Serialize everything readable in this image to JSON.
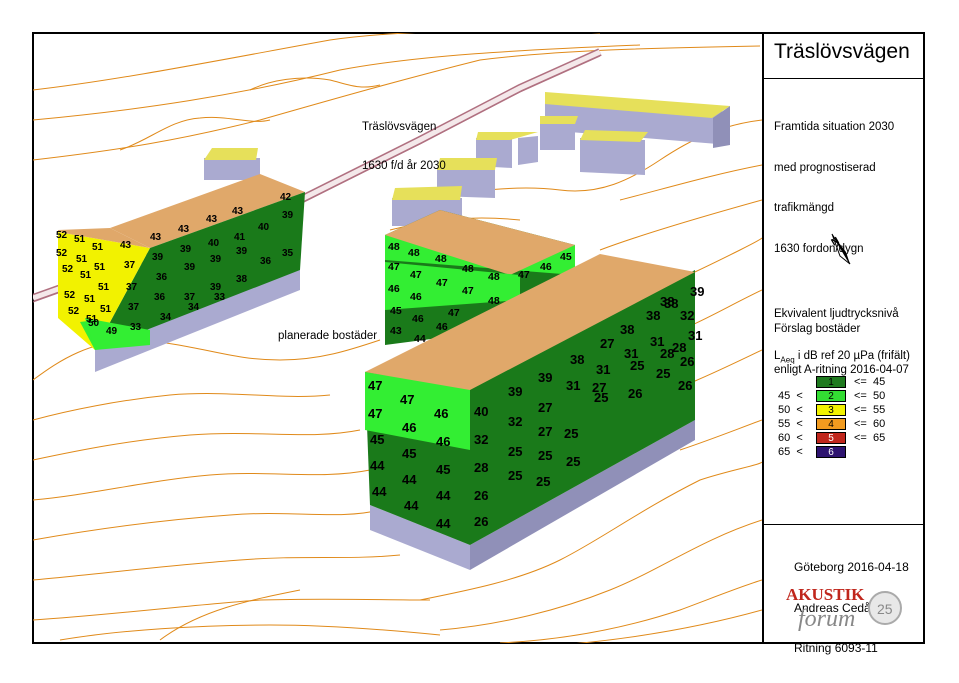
{
  "sidebar": {
    "title": "Träslövsvägen",
    "info_lines": [
      "Framtida situation 2030",
      "med prognostiserad",
      "trafikmängd",
      "1630 fordon/dygn",
      "",
      "Förslag bostäder",
      "enligt A-ritning 2016-04-07"
    ],
    "legend_title": "Ekvivalent ljudtrycksnivå",
    "legend_unit_main": "L",
    "legend_unit_sub": "Aeq",
    "legend_unit_rest": " i dB ref 20 µPa (frifält)",
    "legend": [
      {
        "lo": "",
        "box": "1",
        "hi": "<=  45",
        "color": "#1f7a1f"
      },
      {
        "lo": "45  <",
        "box": "2",
        "hi": "<=  50",
        "color": "#33dd33"
      },
      {
        "lo": "50  <",
        "box": "3",
        "hi": "<=  55",
        "color": "#f2f200"
      },
      {
        "lo": "55  <",
        "box": "4",
        "hi": "<=  60",
        "color": "#f29b1f"
      },
      {
        "lo": "60  <",
        "box": "5",
        "hi": "<=  65",
        "color": "#c0261c"
      },
      {
        "lo": "65  <",
        "box": "6",
        "hi": "",
        "color": "#2e1470"
      }
    ],
    "footer_lines": [
      "Göteborg 2016-04-18",
      "Andreas Cedås",
      "Ritning 6093-11"
    ],
    "logo_text_top": "AKUSTIK",
    "logo_text_bottom": "forum",
    "logo_badge": "25"
  },
  "map": {
    "road_label_lines": [
      "Träslövsvägen",
      "1630 f/d år 2030"
    ],
    "planned_label": "planerade bostäder",
    "colors": {
      "roof": "#e0a86a",
      "green_dark": "#1a7a1a",
      "green_light": "#33ee33",
      "yellow": "#f2f200",
      "base": "#aaaad0",
      "contour": "#e08a1a"
    },
    "building_left_numbers": [
      "52",
      "51",
      "51",
      "52",
      "51",
      "51",
      "52",
      "51",
      "51",
      "52",
      "51",
      "51",
      "52",
      "51",
      "50",
      "49",
      "43",
      "43",
      "43",
      "43",
      "43",
      "42",
      "39",
      "40",
      "41",
      "40",
      "39",
      "39",
      "37",
      "39",
      "39",
      "39",
      "36",
      "36",
      "38",
      "39",
      "37",
      "37",
      "35",
      "36",
      "37",
      "33",
      "34",
      "34",
      "33"
    ],
    "building_mid_numbers": [
      "48",
      "48",
      "48",
      "47",
      "47",
      "48",
      "48",
      "47",
      "46",
      "45",
      "46",
      "46",
      "47",
      "47",
      "48",
      "45",
      "46",
      "47",
      "43",
      "46",
      "44"
    ],
    "building_front_numbers": [
      "47",
      "47",
      "46",
      "47",
      "40",
      "46",
      "46",
      "45",
      "45",
      "32",
      "44",
      "45",
      "44",
      "44",
      "28",
      "44",
      "44",
      "26",
      "44",
      "26",
      "39",
      "39",
      "31",
      "32",
      "27",
      "27",
      "25",
      "25",
      "25",
      "25",
      "25",
      "38",
      "31",
      "27",
      "27",
      "25",
      "25",
      "38",
      "31",
      "26",
      "38",
      "31",
      "28",
      "38",
      "32",
      "25",
      "39",
      "38",
      "31",
      "28",
      "26",
      "25",
      "26"
    ]
  }
}
